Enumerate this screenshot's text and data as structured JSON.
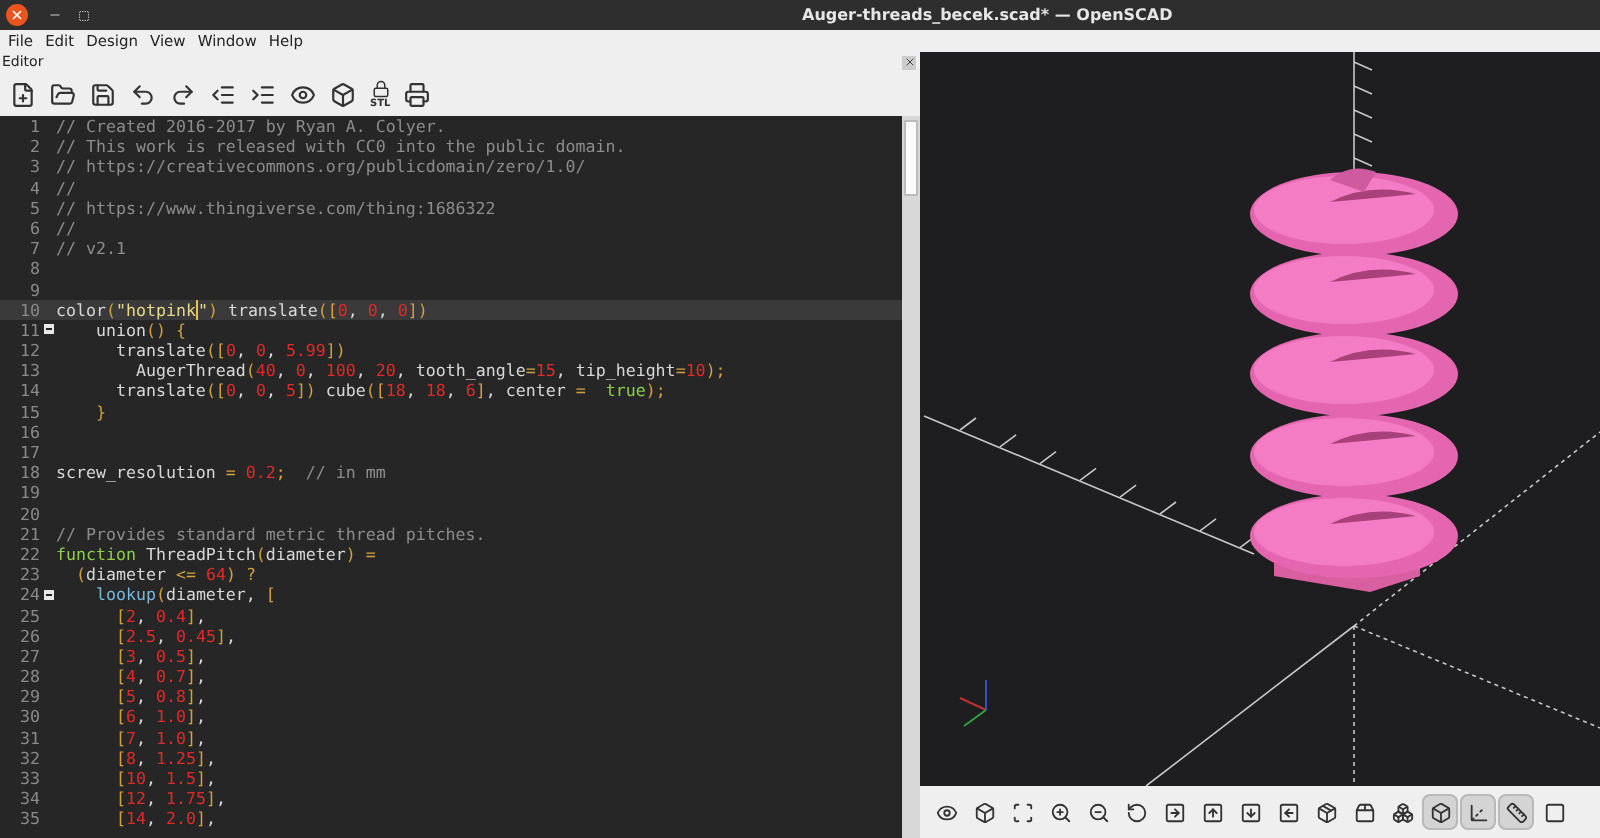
{
  "window": {
    "title": "Auger-threads_becek.scad* — OpenSCAD"
  },
  "menu": [
    "File",
    "Edit",
    "Design",
    "View",
    "Window",
    "Help"
  ],
  "editor": {
    "title": "Editor",
    "toolbar": [
      {
        "kind": "new"
      },
      {
        "kind": "open"
      },
      {
        "kind": "save"
      },
      {
        "kind": "undo"
      },
      {
        "kind": "redo"
      },
      {
        "kind": "unindent"
      },
      {
        "kind": "indent"
      },
      {
        "kind": "preview"
      },
      {
        "kind": "render"
      },
      {
        "kind": "export-stl",
        "label": "STL"
      },
      {
        "kind": "send-print"
      }
    ],
    "lines": [
      {
        "number": "1",
        "tokens": [
          {
            "kind": "comment",
            "text": "// Created 2016-2017 by Ryan A. Colyer."
          }
        ]
      },
      {
        "number": "2",
        "tokens": [
          {
            "kind": "comment",
            "text": "// This work is released with CC0 into the public domain."
          }
        ]
      },
      {
        "number": "3",
        "tokens": [
          {
            "kind": "comment",
            "text": "// https://creativecommons.org/publicdomain/zero/1.0/"
          }
        ]
      },
      {
        "number": "4",
        "tokens": [
          {
            "kind": "comment",
            "text": "//"
          }
        ]
      },
      {
        "number": "5",
        "tokens": [
          {
            "kind": "comment",
            "text": "// https://www.thingiverse.com/thing:1686322"
          }
        ]
      },
      {
        "number": "6",
        "tokens": [
          {
            "kind": "comment",
            "text": "//"
          }
        ]
      },
      {
        "number": "7",
        "tokens": [
          {
            "kind": "comment",
            "text": "// v2.1"
          }
        ]
      },
      {
        "number": "8"
      },
      {
        "number": "9"
      },
      {
        "number": "10",
        "current": true,
        "tokens": [
          {
            "kind": "plain",
            "text": "color"
          },
          {
            "kind": "punct",
            "text": "("
          },
          {
            "kind": "string",
            "text": "\"hotpink"
          },
          {
            "kind": "caret"
          },
          {
            "kind": "string",
            "text": "\""
          },
          {
            "kind": "punct",
            "text": ")"
          },
          {
            "kind": "plain",
            "text": " translate"
          },
          {
            "kind": "punct",
            "text": "(["
          },
          {
            "kind": "number",
            "text": "0"
          },
          {
            "kind": "plain",
            "text": ", "
          },
          {
            "kind": "number",
            "text": "0"
          },
          {
            "kind": "plain",
            "text": ", "
          },
          {
            "kind": "number",
            "text": "0"
          },
          {
            "kind": "punct",
            "text": "])"
          }
        ]
      },
      {
        "number": "11",
        "fold": true,
        "tokens": [
          {
            "kind": "plain",
            "text": "    union"
          },
          {
            "kind": "punct",
            "text": "() {"
          }
        ]
      },
      {
        "number": "12",
        "tokens": [
          {
            "kind": "plain",
            "text": "      translate"
          },
          {
            "kind": "punct",
            "text": "(["
          },
          {
            "kind": "number",
            "text": "0"
          },
          {
            "kind": "plain",
            "text": ", "
          },
          {
            "kind": "number",
            "text": "0"
          },
          {
            "kind": "plain",
            "text": ", "
          },
          {
            "kind": "number",
            "text": "5.99"
          },
          {
            "kind": "punct",
            "text": "])"
          }
        ]
      },
      {
        "number": "13",
        "tokens": [
          {
            "kind": "plain",
            "text": "        AugerThread"
          },
          {
            "kind": "punct",
            "text": "("
          },
          {
            "kind": "number",
            "text": "40"
          },
          {
            "kind": "plain",
            "text": ", "
          },
          {
            "kind": "number",
            "text": "0"
          },
          {
            "kind": "plain",
            "text": ", "
          },
          {
            "kind": "number",
            "text": "100"
          },
          {
            "kind": "plain",
            "text": ", "
          },
          {
            "kind": "number",
            "text": "20"
          },
          {
            "kind": "plain",
            "text": ", tooth_angle"
          },
          {
            "kind": "punct",
            "text": "="
          },
          {
            "kind": "number",
            "text": "15"
          },
          {
            "kind": "plain",
            "text": ", tip_height"
          },
          {
            "kind": "punct",
            "text": "="
          },
          {
            "kind": "number",
            "text": "10"
          },
          {
            "kind": "punct",
            "text": ");"
          }
        ]
      },
      {
        "number": "14",
        "tokens": [
          {
            "kind": "plain",
            "text": "      translate"
          },
          {
            "kind": "punct",
            "text": "(["
          },
          {
            "kind": "number",
            "text": "0"
          },
          {
            "kind": "plain",
            "text": ", "
          },
          {
            "kind": "number",
            "text": "0"
          },
          {
            "kind": "plain",
            "text": ", "
          },
          {
            "kind": "number",
            "text": "5"
          },
          {
            "kind": "punct",
            "text": "])"
          },
          {
            "kind": "plain",
            "text": " cube"
          },
          {
            "kind": "punct",
            "text": "(["
          },
          {
            "kind": "number",
            "text": "18"
          },
          {
            "kind": "plain",
            "text": ", "
          },
          {
            "kind": "number",
            "text": "18"
          },
          {
            "kind": "plain",
            "text": ", "
          },
          {
            "kind": "number",
            "text": "6"
          },
          {
            "kind": "punct",
            "text": "]"
          },
          {
            "kind": "plain",
            "text": ", center "
          },
          {
            "kind": "punct",
            "text": "="
          },
          {
            "kind": "constant",
            "text": "  true"
          },
          {
            "kind": "punct",
            "text": ");"
          }
        ]
      },
      {
        "number": "15",
        "tokens": [
          {
            "kind": "punct",
            "text": "    }"
          }
        ]
      },
      {
        "number": "16"
      },
      {
        "number": "17"
      },
      {
        "number": "18",
        "tokens": [
          {
            "kind": "plain",
            "text": "screw_resolution "
          },
          {
            "kind": "punct",
            "text": "="
          },
          {
            "kind": "number",
            "text": " 0.2"
          },
          {
            "kind": "punct",
            "text": ";"
          },
          {
            "kind": "comment",
            "text": "  // in mm"
          }
        ]
      },
      {
        "number": "19"
      },
      {
        "number": "20"
      },
      {
        "number": "21",
        "tokens": [
          {
            "kind": "comment",
            "text": "// Provides standard metric thread pitches."
          }
        ]
      },
      {
        "number": "22",
        "tokens": [
          {
            "kind": "keyword",
            "text": "function"
          },
          {
            "kind": "plain",
            "text": " ThreadPitch"
          },
          {
            "kind": "punct",
            "text": "("
          },
          {
            "kind": "plain",
            "text": "diameter"
          },
          {
            "kind": "punct",
            "text": ")"
          },
          {
            "kind": "punct",
            "text": " ="
          }
        ]
      },
      {
        "number": "23",
        "tokens": [
          {
            "kind": "punct",
            "text": "  ("
          },
          {
            "kind": "plain",
            "text": "diameter "
          },
          {
            "kind": "punct",
            "text": "<="
          },
          {
            "kind": "number",
            "text": " 64"
          },
          {
            "kind": "punct",
            "text": ")"
          },
          {
            "kind": "punct",
            "text": " ?"
          }
        ]
      },
      {
        "number": "24",
        "fold": true,
        "tokens": [
          {
            "kind": "builtin",
            "text": "    lookup"
          },
          {
            "kind": "punct",
            "text": "("
          },
          {
            "kind": "plain",
            "text": "diameter, "
          },
          {
            "kind": "punct",
            "text": "["
          }
        ]
      },
      {
        "number": "25",
        "tokens": [
          {
            "kind": "punct",
            "text": "      ["
          },
          {
            "kind": "number",
            "text": "2"
          },
          {
            "kind": "plain",
            "text": ", "
          },
          {
            "kind": "number",
            "text": "0.4"
          },
          {
            "kind": "punct",
            "text": "]"
          },
          {
            "kind": "plain",
            "text": ","
          }
        ]
      },
      {
        "number": "26",
        "tokens": [
          {
            "kind": "punct",
            "text": "      ["
          },
          {
            "kind": "number",
            "text": "2.5"
          },
          {
            "kind": "plain",
            "text": ", "
          },
          {
            "kind": "number",
            "text": "0.45"
          },
          {
            "kind": "punct",
            "text": "]"
          },
          {
            "kind": "plain",
            "text": ","
          }
        ]
      },
      {
        "number": "27",
        "tokens": [
          {
            "kind": "punct",
            "text": "      ["
          },
          {
            "kind": "number",
            "text": "3"
          },
          {
            "kind": "plain",
            "text": ", "
          },
          {
            "kind": "number",
            "text": "0.5"
          },
          {
            "kind": "punct",
            "text": "]"
          },
          {
            "kind": "plain",
            "text": ","
          }
        ]
      },
      {
        "number": "28",
        "tokens": [
          {
            "kind": "punct",
            "text": "      ["
          },
          {
            "kind": "number",
            "text": "4"
          },
          {
            "kind": "plain",
            "text": ", "
          },
          {
            "kind": "number",
            "text": "0.7"
          },
          {
            "kind": "punct",
            "text": "]"
          },
          {
            "kind": "plain",
            "text": ","
          }
        ]
      },
      {
        "number": "29",
        "tokens": [
          {
            "kind": "punct",
            "text": "      ["
          },
          {
            "kind": "number",
            "text": "5"
          },
          {
            "kind": "plain",
            "text": ", "
          },
          {
            "kind": "number",
            "text": "0.8"
          },
          {
            "kind": "punct",
            "text": "]"
          },
          {
            "kind": "plain",
            "text": ","
          }
        ]
      },
      {
        "number": "30",
        "tokens": [
          {
            "kind": "punct",
            "text": "      ["
          },
          {
            "kind": "number",
            "text": "6"
          },
          {
            "kind": "plain",
            "text": ", "
          },
          {
            "kind": "number",
            "text": "1.0"
          },
          {
            "kind": "punct",
            "text": "]"
          },
          {
            "kind": "plain",
            "text": ","
          }
        ]
      },
      {
        "number": "31",
        "tokens": [
          {
            "kind": "punct",
            "text": "      ["
          },
          {
            "kind": "number",
            "text": "7"
          },
          {
            "kind": "plain",
            "text": ", "
          },
          {
            "kind": "number",
            "text": "1.0"
          },
          {
            "kind": "punct",
            "text": "]"
          },
          {
            "kind": "plain",
            "text": ","
          }
        ]
      },
      {
        "number": "32",
        "tokens": [
          {
            "kind": "punct",
            "text": "      ["
          },
          {
            "kind": "number",
            "text": "8"
          },
          {
            "kind": "plain",
            "text": ", "
          },
          {
            "kind": "number",
            "text": "1.25"
          },
          {
            "kind": "punct",
            "text": "]"
          },
          {
            "kind": "plain",
            "text": ","
          }
        ]
      },
      {
        "number": "33",
        "tokens": [
          {
            "kind": "punct",
            "text": "      ["
          },
          {
            "kind": "number",
            "text": "10"
          },
          {
            "kind": "plain",
            "text": ", "
          },
          {
            "kind": "number",
            "text": "1.5"
          },
          {
            "kind": "punct",
            "text": "]"
          },
          {
            "kind": "plain",
            "text": ","
          }
        ]
      },
      {
        "number": "34",
        "tokens": [
          {
            "kind": "punct",
            "text": "      ["
          },
          {
            "kind": "number",
            "text": "12"
          },
          {
            "kind": "plain",
            "text": ", "
          },
          {
            "kind": "number",
            "text": "1.75"
          },
          {
            "kind": "punct",
            "text": "]"
          },
          {
            "kind": "plain",
            "text": ","
          }
        ]
      },
      {
        "number": "35",
        "tokens": [
          {
            "kind": "punct",
            "text": "      ["
          },
          {
            "kind": "number",
            "text": "14"
          },
          {
            "kind": "plain",
            "text": ", "
          },
          {
            "kind": "number",
            "text": "2.0"
          },
          {
            "kind": "punct",
            "text": "]"
          },
          {
            "kind": "plain",
            "text": ","
          }
        ]
      }
    ]
  },
  "viewport": {
    "toolbar": [
      {
        "kind": "preview",
        "selected": false
      },
      {
        "kind": "render",
        "selected": false
      },
      {
        "kind": "view-all",
        "selected": false
      },
      {
        "kind": "zoom-in",
        "selected": false
      },
      {
        "kind": "zoom-out",
        "selected": false
      },
      {
        "kind": "reset-view",
        "selected": false
      },
      {
        "kind": "view-right",
        "selected": false
      },
      {
        "kind": "view-top",
        "selected": false
      },
      {
        "kind": "view-bottom",
        "selected": false
      },
      {
        "kind": "view-left",
        "selected": false
      },
      {
        "kind": "view-front",
        "selected": false
      },
      {
        "kind": "view-back",
        "selected": false
      },
      {
        "kind": "perspective",
        "selected": false
      },
      {
        "kind": "orthogonal",
        "selected": true
      },
      {
        "kind": "axes",
        "selected": true
      },
      {
        "kind": "scale-markers",
        "selected": true
      },
      {
        "kind": "edges",
        "selected": false
      }
    ]
  }
}
